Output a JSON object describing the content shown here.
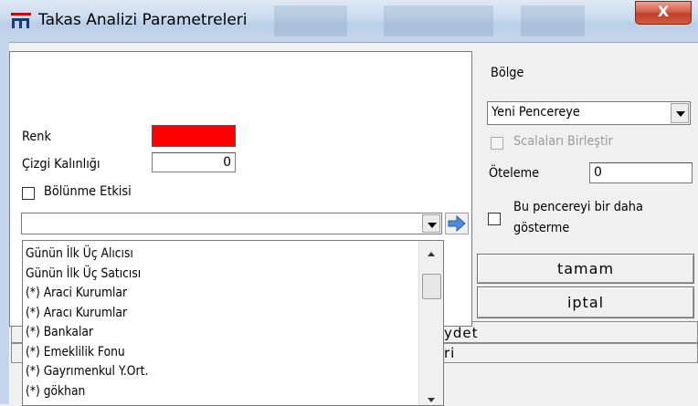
{
  "window": {
    "title": "Takas Analizi Parametreleri",
    "close_symbol": "X"
  },
  "colors": {
    "renk_swatch": "#ff0000"
  },
  "left": {
    "renk_label": "Renk",
    "cizgi_label": "Çizgi Kalınlığı",
    "cizgi_value": "0",
    "bolunme_label": "Bölünme Etkisi",
    "selector_value": ""
  },
  "list": {
    "items": [
      "Günün İlk Üç Alıcısı",
      "Günün İlk Üç Satıcısı",
      "(*) Araci Kurumlar",
      "(*) Aracı Kurumlar",
      "(*) Bankalar",
      "(*) Emeklilik Fonu",
      "(*) Gayrımenkul Y.Ort.",
      "(*) gökhan"
    ]
  },
  "right": {
    "bolge_label": "Bölge",
    "bolge_value": "Yeni Pencereye",
    "scala_label": "Scalaları Birleştir",
    "oteleme_label": "Öteleme",
    "oteleme_value": "0",
    "bu_pencere_line1": "Bu pencereyi bir daha",
    "bu_pencere_line2": "gösterme",
    "tamam_label": "tamam",
    "iptal_label": "iptal"
  },
  "background_strips": {
    "kaydet_partial": "ydet",
    "partial_2": "ri"
  }
}
